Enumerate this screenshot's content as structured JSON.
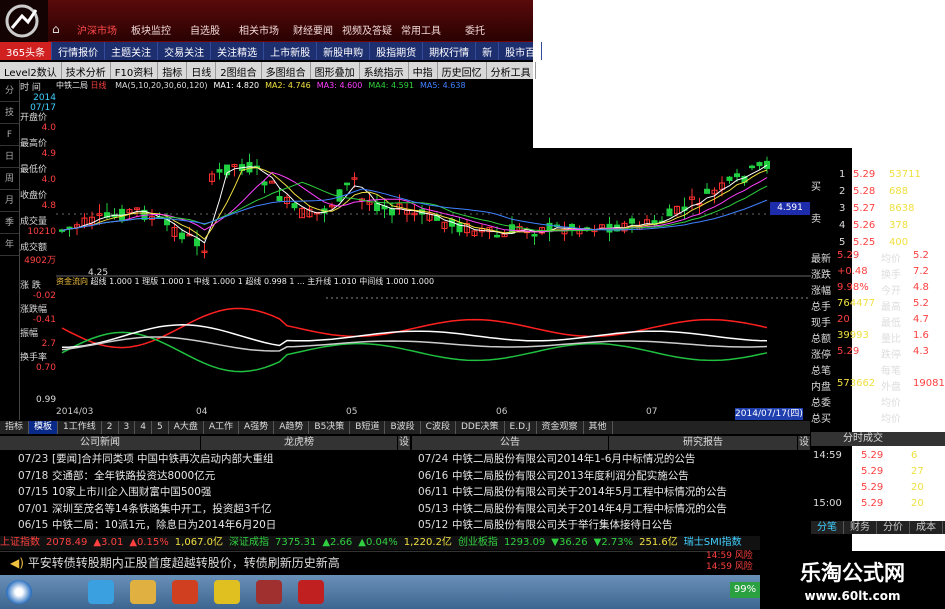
{
  "menu": {
    "items": [
      "沪深市场",
      "板块监控",
      "自选股",
      "相关市场",
      "财经要闻",
      "视频及答疑",
      "常用工具",
      "委托"
    ]
  },
  "tabs": [
    "365头条",
    "行情报价",
    "主题关注",
    "交易关注",
    "关注精选",
    "上市新股",
    "新股申购",
    "股指期货",
    "期权行情",
    "新",
    "股市百"
  ],
  "toolbar": [
    "Level2数认",
    "技术分析",
    "F10资料",
    "指标",
    "日线",
    "2图组合",
    "多图组合",
    "图形叠加",
    "系统指示",
    "中指",
    "历史回忆",
    "分析工具"
  ],
  "stock": {
    "name": "中铁二局",
    "period": "日线"
  },
  "ma_legend": [
    {
      "text": "MA(5,10,20,30,60,120)",
      "color": "#dddddd"
    },
    {
      "text": "MA1: 4.820",
      "color": "#ffffff"
    },
    {
      "text": "MA2: 4.746",
      "color": "#f0e040"
    },
    {
      "text": "MA3: 4.600",
      "color": "#ff40ff"
    },
    {
      "text": "MA4: 4.591",
      "color": "#30d040"
    },
    {
      "text": "MA5: 4.638",
      "color": "#4080ff"
    }
  ],
  "info_col": [
    {
      "label": "时 间",
      "value": "2014",
      "value2": "07/17"
    },
    {
      "label": "开盘价",
      "value": "4.0"
    },
    {
      "label": "最高价",
      "value": "4.9"
    },
    {
      "label": "最低价",
      "value": "4.0"
    },
    {
      "label": "收盘价",
      "value": "4.8"
    },
    {
      "label": "成交量",
      "value": "10210"
    },
    {
      "label": "成交额",
      "value": "4902万"
    },
    {
      "label": "涨 跌",
      "value": "-0.02"
    },
    {
      "label": "涨跌幅",
      "value": "-0.41"
    },
    {
      "label": "振幅",
      "value": "2.7"
    },
    {
      "label": "换手率",
      "value": "0.70"
    }
  ],
  "chart_labels": {
    "low_price": "4.25",
    "price_tag": "4.591",
    "y_min": "0.99",
    "date_tag": "2014/07/17(四)"
  },
  "indicator_legend": {
    "name": "资金流向",
    "text": "超线  1.000  1  理版  1.000  1  中线  1.000  1  超线  0.998  1  ...  主升线  1.010  中间线  1.000  1.000"
  },
  "x_axis": {
    "labels": [
      "2014/03",
      "04",
      "05",
      "06",
      "07"
    ]
  },
  "indicator_tabs": [
    "指标",
    "模板",
    "1工作线",
    "2",
    "3",
    "4",
    "5",
    "A大盘",
    "A工作",
    "A强势",
    "A趋势",
    "B5决策",
    "B短道",
    "B波段",
    "C波段",
    "DDE决策",
    "E.D.J",
    "资金观察",
    "其他"
  ],
  "quote": {
    "ask_label": "卖",
    "bid_label": "买",
    "bids": [
      {
        "lvl": "1",
        "price": "5.29",
        "vol": "53711"
      },
      {
        "lvl": "2",
        "price": "5.28",
        "vol": "688"
      },
      {
        "lvl": "3",
        "price": "5.27",
        "vol": "8638"
      },
      {
        "lvl": "4",
        "price": "5.26",
        "vol": "378"
      },
      {
        "lvl": "5",
        "price": "5.25",
        "vol": "400"
      }
    ],
    "stats": [
      {
        "l": "最新",
        "v": "5.29",
        "l2": "均价",
        "v2": "5.2"
      },
      {
        "l": "涨跌",
        "v": "+0.48",
        "l2": "换手",
        "v2": "7.2"
      },
      {
        "l": "涨幅",
        "v": "9.98%",
        "l2": "今开",
        "v2": "4.8"
      },
      {
        "l": "总手",
        "v": "764477",
        "l2": "最高",
        "v2": "5.2"
      },
      {
        "l": "现手",
        "v": "20",
        "l2": "最低",
        "v2": "4.7"
      },
      {
        "l": "总额",
        "v": "39993",
        "l2": "量比",
        "v2": "1.6"
      },
      {
        "l": "涨停",
        "v": "5.29",
        "l2": "跌停",
        "v2": "4.3"
      },
      {
        "l": "总笔",
        "v": "",
        "l2": "每笔",
        "v2": ""
      },
      {
        "l": "内盘",
        "v": "573662",
        "l2": "外盘",
        "v2": "190815"
      },
      {
        "l": "总委",
        "v": "",
        "l2": "均价",
        "v2": ""
      },
      {
        "l": "总买",
        "v": "",
        "l2": "均价",
        "v2": ""
      }
    ]
  },
  "news_left": {
    "heads": [
      "公司新闻",
      "龙虎榜",
      "设"
    ],
    "items": [
      {
        "date": "07/23",
        "text": "[要闻]合并同类项 中国中铁再次启动内部大重组"
      },
      {
        "date": "07/18",
        "text": "交通部：全年铁路投资达8000亿元"
      },
      {
        "date": "07/15",
        "text": "10家上市川企入围财富中国500强"
      },
      {
        "date": "07/01",
        "text": "深圳至茂名等14条铁路集中开工，投资超3千亿"
      },
      {
        "date": "06/15",
        "text": "中铁二局：10派1元，除息日为2014年6月20日"
      }
    ]
  },
  "news_right": {
    "heads": [
      "公告",
      "研究报告",
      "设"
    ],
    "items": [
      {
        "date": "07/24",
        "text": "中铁二局股份有限公司2014年1-6月中标情况的公告"
      },
      {
        "date": "06/16",
        "text": "中铁二局股份有限公司2013年度利润分配实施公告"
      },
      {
        "date": "06/11",
        "text": "中铁二局股份有限公司关于2014年5月工程中标情况的公告"
      },
      {
        "date": "05/13",
        "text": "中铁二局股份有限公司关于2014年4月工程中标情况的公告"
      },
      {
        "date": "05/12",
        "text": "中铁二局股份有限公司关于举行集体接待日公告"
      }
    ]
  },
  "trades": {
    "head": "分时成交",
    "rows": [
      {
        "t": "14:59",
        "p": "5.29",
        "v": "6"
      },
      {
        "t": "",
        "p": "5.29",
        "v": "27"
      },
      {
        "t": "",
        "p": "5.29",
        "v": "20"
      },
      {
        "t": "15:00",
        "p": "5.29",
        "v": "20"
      }
    ],
    "tabs": [
      "分笔",
      "财务",
      "分价",
      "成本"
    ]
  },
  "ticker": [
    {
      "t": "上证指数",
      "c": "#ff4040"
    },
    {
      "t": "2078.49",
      "c": "#ff4040"
    },
    {
      "t": "▲3.01",
      "c": "#ff4040"
    },
    {
      "t": "▲0.15%",
      "c": "#ff4040"
    },
    {
      "t": "1,067.0亿",
      "c": "#f0e040"
    },
    {
      "t": "深证成指",
      "c": "#30d040"
    },
    {
      "t": "7375.31",
      "c": "#30d040"
    },
    {
      "t": "▲2.66",
      "c": "#30d040"
    },
    {
      "t": "▲0.04%",
      "c": "#30d040"
    },
    {
      "t": "1,220.2亿",
      "c": "#f0e040"
    },
    {
      "t": "创业板指",
      "c": "#30d040"
    },
    {
      "t": "1293.09",
      "c": "#30d040"
    },
    {
      "t": "▼36.26",
      "c": "#30d040"
    },
    {
      "t": "▼2.73%",
      "c": "#30d040"
    },
    {
      "t": "251.6亿",
      "c": "#f0e040"
    },
    {
      "t": "瑞士SMI指数",
      "c": "#40d0ff"
    }
  ],
  "scroll_text": "平安转债转股期内正股首度超越转股价，转债刷新历史新高",
  "alerts": [
    "14:59 风险",
    "14:59 风险"
  ],
  "tray": {
    "pct": "99%"
  },
  "watermark": {
    "title": "乐淘公式网",
    "url": "www.60lt.com"
  },
  "chart_data": {
    "type": "candlestick",
    "x_range": [
      "2014/03",
      "2014/07/17"
    ],
    "series": [
      {
        "name": "MA1",
        "color": "#ffffff"
      },
      {
        "name": "MA2",
        "color": "#f0e040"
      },
      {
        "name": "MA3",
        "color": "#ff40ff"
      },
      {
        "name": "MA4",
        "color": "#30d040"
      },
      {
        "name": "MA5",
        "color": "#4080ff"
      }
    ]
  }
}
